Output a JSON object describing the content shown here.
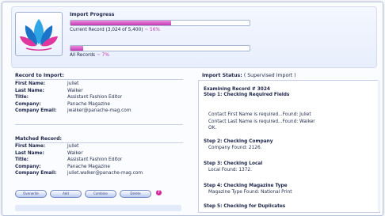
{
  "colors": {
    "accent": "#c03ab0",
    "border": "#a8b6d6",
    "text": "#1b2448"
  },
  "header": {
    "logo": "lotus-logo",
    "progress_title": "Import Progress",
    "current": {
      "label": "Current Record (3,024 of 5,400)",
      "pct": "56%",
      "fraction": 0.56
    },
    "all": {
      "label": "All Records",
      "pct": "7%",
      "fraction": 0.07
    }
  },
  "record_to_import": {
    "title": "Record to Import:",
    "rows": [
      {
        "k": "First Name:",
        "v": "Juliet"
      },
      {
        "k": "Last Name:",
        "v": "Walker"
      },
      {
        "k": "Title:",
        "v": "Assistant Fashion Editor"
      },
      {
        "k": "Company:",
        "v": "Panache Magazine"
      },
      {
        "k": "Company Email:",
        "v": "jwalker@panache-mag.com"
      }
    ]
  },
  "matched_record": {
    "title": "Matched Record:",
    "rows": [
      {
        "k": "First Name:",
        "v": "Juliet"
      },
      {
        "k": "Last Name:",
        "v": "Walker"
      },
      {
        "k": "Title:",
        "v": "Assistant Fashion Editor"
      },
      {
        "k": "Company:",
        "v": "Panache Magazine"
      },
      {
        "k": "Company Email:",
        "v": "juliet.walker@panache-mag.com"
      }
    ]
  },
  "buttons": [
    "Overwrite",
    "Add",
    "Combine",
    "Delete"
  ],
  "help_icon": "help-icon",
  "status": {
    "title": "Import Status:",
    "mode": "( Supervised Import )",
    "lines": [
      {
        "t": "Examining Record # 3024",
        "b": true,
        "ind": false
      },
      {
        "t": "Step 1: Checking Required Fields",
        "b": true,
        "ind": false
      },
      {
        "t": "Contact First Name is required...Found: Juliet",
        "b": false,
        "ind": true
      },
      {
        "t": "Contact Last Name is required...Found: Walker",
        "b": false,
        "ind": true
      },
      {
        "t": "OK.",
        "b": false,
        "ind": true
      },
      {
        "t": "Step 2: Checking Company",
        "b": true,
        "ind": false
      },
      {
        "t": "Company Found: 2126.",
        "b": false,
        "ind": true
      },
      {
        "t": "Step 3: Checking Local",
        "b": true,
        "ind": false
      },
      {
        "t": "Local Found: 1372.",
        "b": false,
        "ind": true
      },
      {
        "t": "Step 4: Checking Magazine Type",
        "b": true,
        "ind": false
      },
      {
        "t": "Magazine Type Found: National Print",
        "b": false,
        "ind": true
      },
      {
        "t": "Step 5: Checking for Duplicates",
        "b": true,
        "ind": false
      }
    ]
  }
}
